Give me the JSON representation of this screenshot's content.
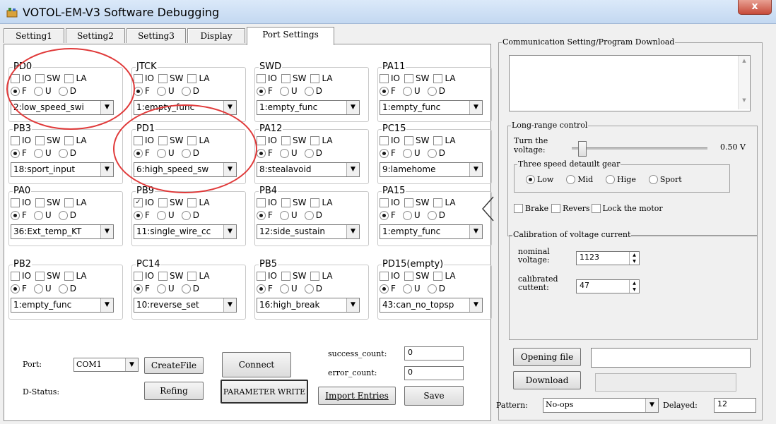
{
  "window": {
    "title": "VOTOL-EM-V3 Software Debugging",
    "close_label": "x"
  },
  "tabs": [
    "Setting1",
    "Setting2",
    "Setting3",
    "Display",
    "Port Settings"
  ],
  "option_labels": {
    "io": "IO",
    "sw": "SW",
    "la": "LA",
    "f": "F",
    "u": "U",
    "d": "D"
  },
  "pins": [
    {
      "name": "PD0",
      "func": "2:low_speed_swi",
      "io_checked": false
    },
    {
      "name": "JTCK",
      "func": "1:empty_func",
      "io_checked": false
    },
    {
      "name": "SWD",
      "func": "1:empty_func",
      "io_checked": false
    },
    {
      "name": "PA11",
      "func": "1:empty_func",
      "io_checked": false
    },
    {
      "name": "PB3",
      "func": "18:sport_input",
      "io_checked": false
    },
    {
      "name": "PD1",
      "func": "6:high_speed_sw",
      "io_checked": false
    },
    {
      "name": "PA12",
      "func": "8:stealavoid",
      "io_checked": false
    },
    {
      "name": "PC15",
      "func": "9:lamehome",
      "io_checked": false
    },
    {
      "name": "PA0",
      "func": "36:Ext_temp_KT",
      "io_checked": false
    },
    {
      "name": "PB9",
      "func": "11:single_wire_cc",
      "io_checked": true
    },
    {
      "name": "PB4",
      "func": "12:side_sustain",
      "io_checked": false
    },
    {
      "name": "PA15",
      "func": "1:empty_func",
      "io_checked": false
    },
    {
      "name": "PB2",
      "func": "1:empty_func",
      "io_checked": false
    },
    {
      "name": "PC14",
      "func": "10:reverse_set",
      "io_checked": false
    },
    {
      "name": "PB5",
      "func": "16:high_break",
      "io_checked": false
    },
    {
      "name": "PD15(empty)",
      "func": "43:can_no_topsp",
      "io_checked": false
    }
  ],
  "bottom": {
    "port_label": "Port:",
    "port_value": "COM1",
    "create_file": "CreateFile",
    "connect": "Connect",
    "success_label": "success_count:",
    "success_value": "0",
    "error_label": "error_count:",
    "error_value": "0",
    "dstatus_label": "D-Status:",
    "refing": "Refing",
    "param_write": "PARAMETER WRITE",
    "import_entries": "Import Entries",
    "save": "Save"
  },
  "collapse_arrow": "<",
  "comm": {
    "title": "Communication Setting/Program Download",
    "long_range": "Long-range control",
    "turn_voltage_1": "Turn the",
    "turn_voltage_2": "voltage:",
    "voltage_value": "0.50 V",
    "voltage_level": 0.05,
    "gear_title": "Three speed detauilt gear",
    "gears": [
      "Low",
      "Mid",
      "Hige",
      "Sport"
    ],
    "gear_selected": "Low",
    "brake": "Brake",
    "reverse": "Revers",
    "lock": "Lock the motor",
    "calib_title": "Calibration of voltage current",
    "nominal_1": "nominal",
    "nominal_2": "voltage:",
    "nominal_value": "1123",
    "calibrated_1": "calibrated",
    "calibrated_2": "cuttent:",
    "calibrated_value": "47",
    "opening_file": "Opening file",
    "download": "Download",
    "pattern_label": "Pattern:",
    "pattern_value": "No-ops",
    "delayed_label": "Delayed:",
    "delayed_value": "12"
  },
  "colors": {
    "highlight_ring": "#e03a3a",
    "tab_active": "#ffffff"
  }
}
